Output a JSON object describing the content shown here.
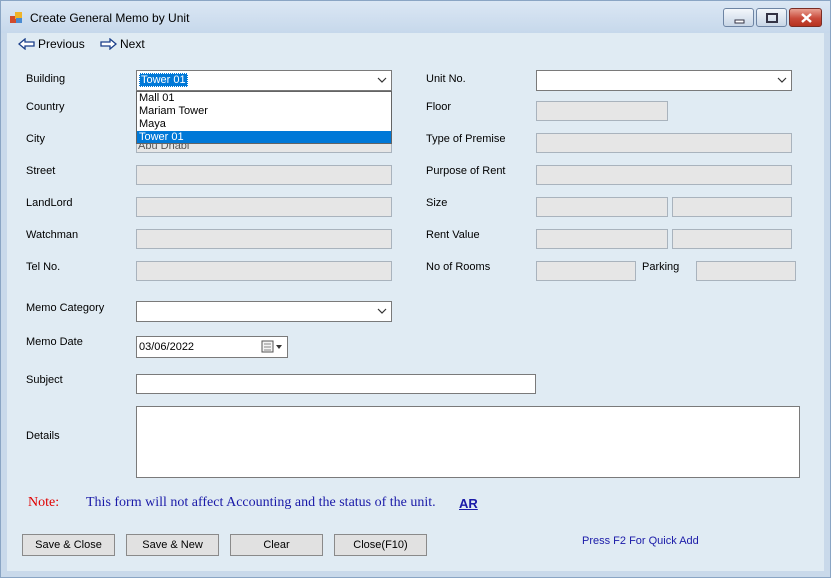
{
  "window": {
    "title": "Create General Memo by Unit"
  },
  "nav": {
    "previous_label": "Previous",
    "next_label": "Next"
  },
  "left_form": {
    "building_label": "Building",
    "building_value": "Tower 01",
    "country_label": "Country",
    "city_label": "City",
    "city_value_partial": "Abu Dhabi",
    "street_label": "Street",
    "landlord_label": "LandLord",
    "watchman_label": "Watchman",
    "tel_label": "Tel No."
  },
  "building_dropdown": {
    "options": [
      "Mall 01",
      "Mariam Tower",
      "Maya",
      "Tower 01"
    ],
    "selected": "Tower 01"
  },
  "right_form": {
    "unit_label": "Unit No.",
    "floor_label": "Floor",
    "type_label": "Type of Premise",
    "purpose_label": "Purpose of Rent",
    "size_label": "Size",
    "rent_label": "Rent Value",
    "rooms_label": "No of Rooms",
    "parking_label": "Parking"
  },
  "memo": {
    "category_label": "Memo Category",
    "date_label": "Memo Date",
    "date_value": "03/06/2022",
    "subject_label": "Subject",
    "details_label": "Details"
  },
  "note": {
    "label": "Note:",
    "text": "This form will not affect Accounting and the status of the unit.",
    "link": "AR"
  },
  "buttons": {
    "save_close": "Save & Close",
    "save_new": "Save & New",
    "clear": "Clear",
    "close": "Close(F10)"
  },
  "hint": "Press F2 For Quick Add",
  "colors": {
    "selection": "#0078d7",
    "note_label": "#e00000",
    "note_text": "#1a1aa8"
  }
}
